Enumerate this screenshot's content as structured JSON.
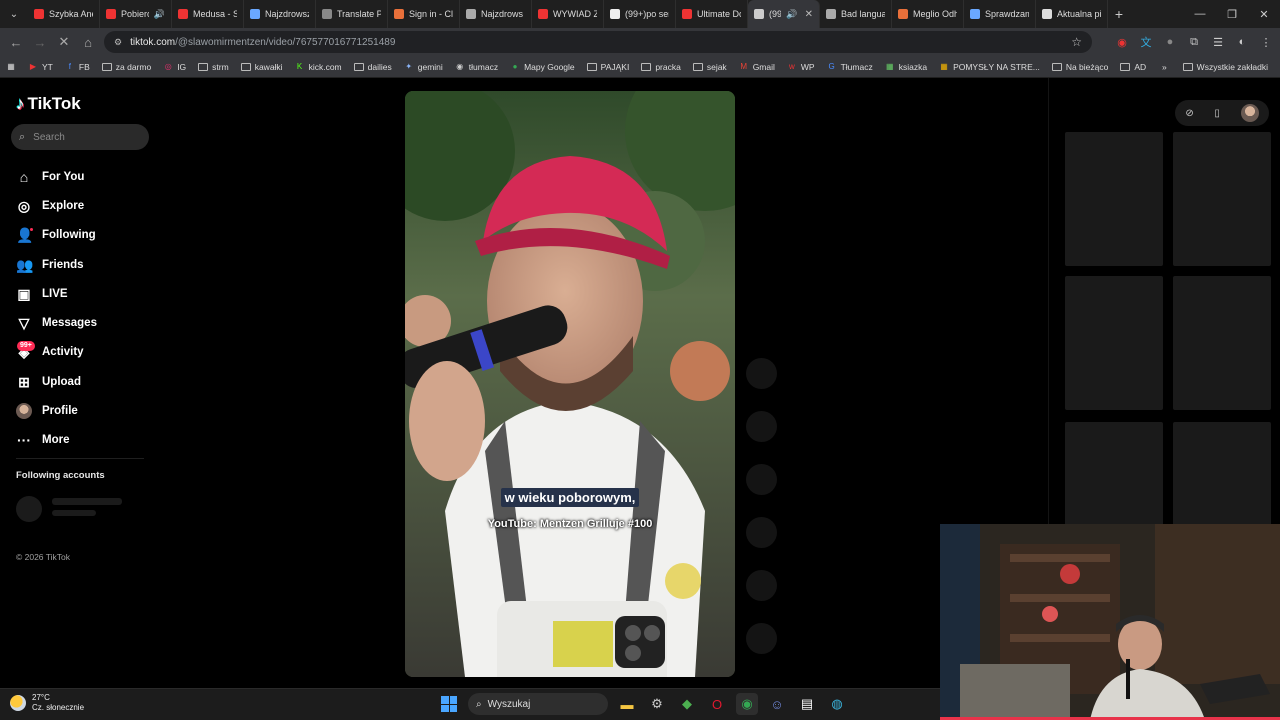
{
  "browser": {
    "tabs": [
      {
        "title": "Szybka Ane",
        "color": "#e33"
      },
      {
        "title": "Pobiero",
        "color": "#e33",
        "audio": "🔊"
      },
      {
        "title": "Medusa - S",
        "color": "#e33"
      },
      {
        "title": "Najzdrowsz",
        "color": "#6aa8ff"
      },
      {
        "title": "Translate Po",
        "color": "#888"
      },
      {
        "title": "Sign in - Clc",
        "color": "#e9703a"
      },
      {
        "title": "Najzdrows",
        "color": "#aaa"
      },
      {
        "title": "WYWIAD Z",
        "color": "#e33"
      },
      {
        "title": "(99+)po ser",
        "color": "#eee"
      },
      {
        "title": "Ultimate Dc",
        "color": "#e33"
      },
      {
        "title": "(99-",
        "color": "#ccc",
        "audio": "🔊",
        "active": true
      },
      {
        "title": "Bad langua",
        "color": "#aaa"
      },
      {
        "title": "Meglio Odh",
        "color": "#e9703a"
      },
      {
        "title": "Sprawdzam",
        "color": "#6aa8ff"
      },
      {
        "title": "Aktualna pi",
        "color": "#ddd"
      }
    ],
    "active_tab_close": "✕",
    "new_tab": "+",
    "url_domain": "tiktok.com",
    "url_path": "/@slawomirmentzen/video/7675770167712514​89",
    "bookmarks": [
      {
        "label": "YT",
        "icon": "▶",
        "color": "#e33"
      },
      {
        "label": "FB",
        "icon": "f",
        "color": "#4a8cff"
      },
      {
        "label": "za darmo",
        "icon": "folder"
      },
      {
        "label": "IG",
        "icon": "◎",
        "color": "#e1306c"
      },
      {
        "label": "strm",
        "icon": "folder"
      },
      {
        "label": "kawałki",
        "icon": "folder"
      },
      {
        "label": "kick.com",
        "icon": "K",
        "color": "#53fc18"
      },
      {
        "label": "dailies",
        "icon": "folder"
      },
      {
        "label": "gemini",
        "icon": "✦",
        "color": "#8ab4f8"
      },
      {
        "label": "tłumacz",
        "icon": "◉",
        "color": "#ccc"
      },
      {
        "label": "Mapy Google",
        "icon": "●",
        "color": "#34a853"
      },
      {
        "label": "PAJĄKI",
        "icon": "folder"
      },
      {
        "label": "pracka",
        "icon": "folder"
      },
      {
        "label": "sejak",
        "icon": "folder"
      },
      {
        "label": "Gmail",
        "icon": "M",
        "color": "#ea4335"
      },
      {
        "label": "WP",
        "icon": "w",
        "color": "#e33"
      },
      {
        "label": "Tłumacz",
        "icon": "G",
        "color": "#4a8cff"
      },
      {
        "label": "ksiazka",
        "icon": "▦",
        "color": "#6c6"
      },
      {
        "label": "POMYSŁY NA STRE...",
        "icon": "▦",
        "color": "#f4b400"
      },
      {
        "label": "Na bieżąco",
        "icon": "folder"
      },
      {
        "label": "AD",
        "icon": "folder"
      }
    ],
    "bookmarks_overflow": "»",
    "all_bookmarks": "Wszystkie zakładki"
  },
  "tiktok": {
    "logo": "TikTok",
    "search_placeholder": "Search",
    "menu": [
      {
        "label": "For You",
        "icon": "⌂",
        "name": "for-you"
      },
      {
        "label": "Explore",
        "icon": "◎",
        "name": "explore"
      },
      {
        "label": "Following",
        "icon": "👤",
        "name": "following"
      },
      {
        "label": "Friends",
        "icon": "👥",
        "name": "friends"
      },
      {
        "label": "LIVE",
        "icon": "▣",
        "name": "live"
      },
      {
        "label": "Messages",
        "icon": "▽",
        "name": "messages"
      },
      {
        "label": "Activity",
        "icon": "◈",
        "name": "activity"
      },
      {
        "label": "Upload",
        "icon": "⊞",
        "name": "upload"
      },
      {
        "label": "Profile",
        "icon": "",
        "name": "profile"
      },
      {
        "label": "More",
        "icon": "···",
        "name": "more"
      }
    ],
    "activity_badge": "99+",
    "following_accounts": "Following accounts",
    "copyright": "© 2026 TikTok",
    "video_caption_1": "w wieku poborowym,",
    "video_caption_2": "YouTube: Mentzen Grilluje #100"
  },
  "taskbar": {
    "temperature": "27°C",
    "weather": "Cz. słonecznie",
    "search_label": "Wyszukaj"
  }
}
